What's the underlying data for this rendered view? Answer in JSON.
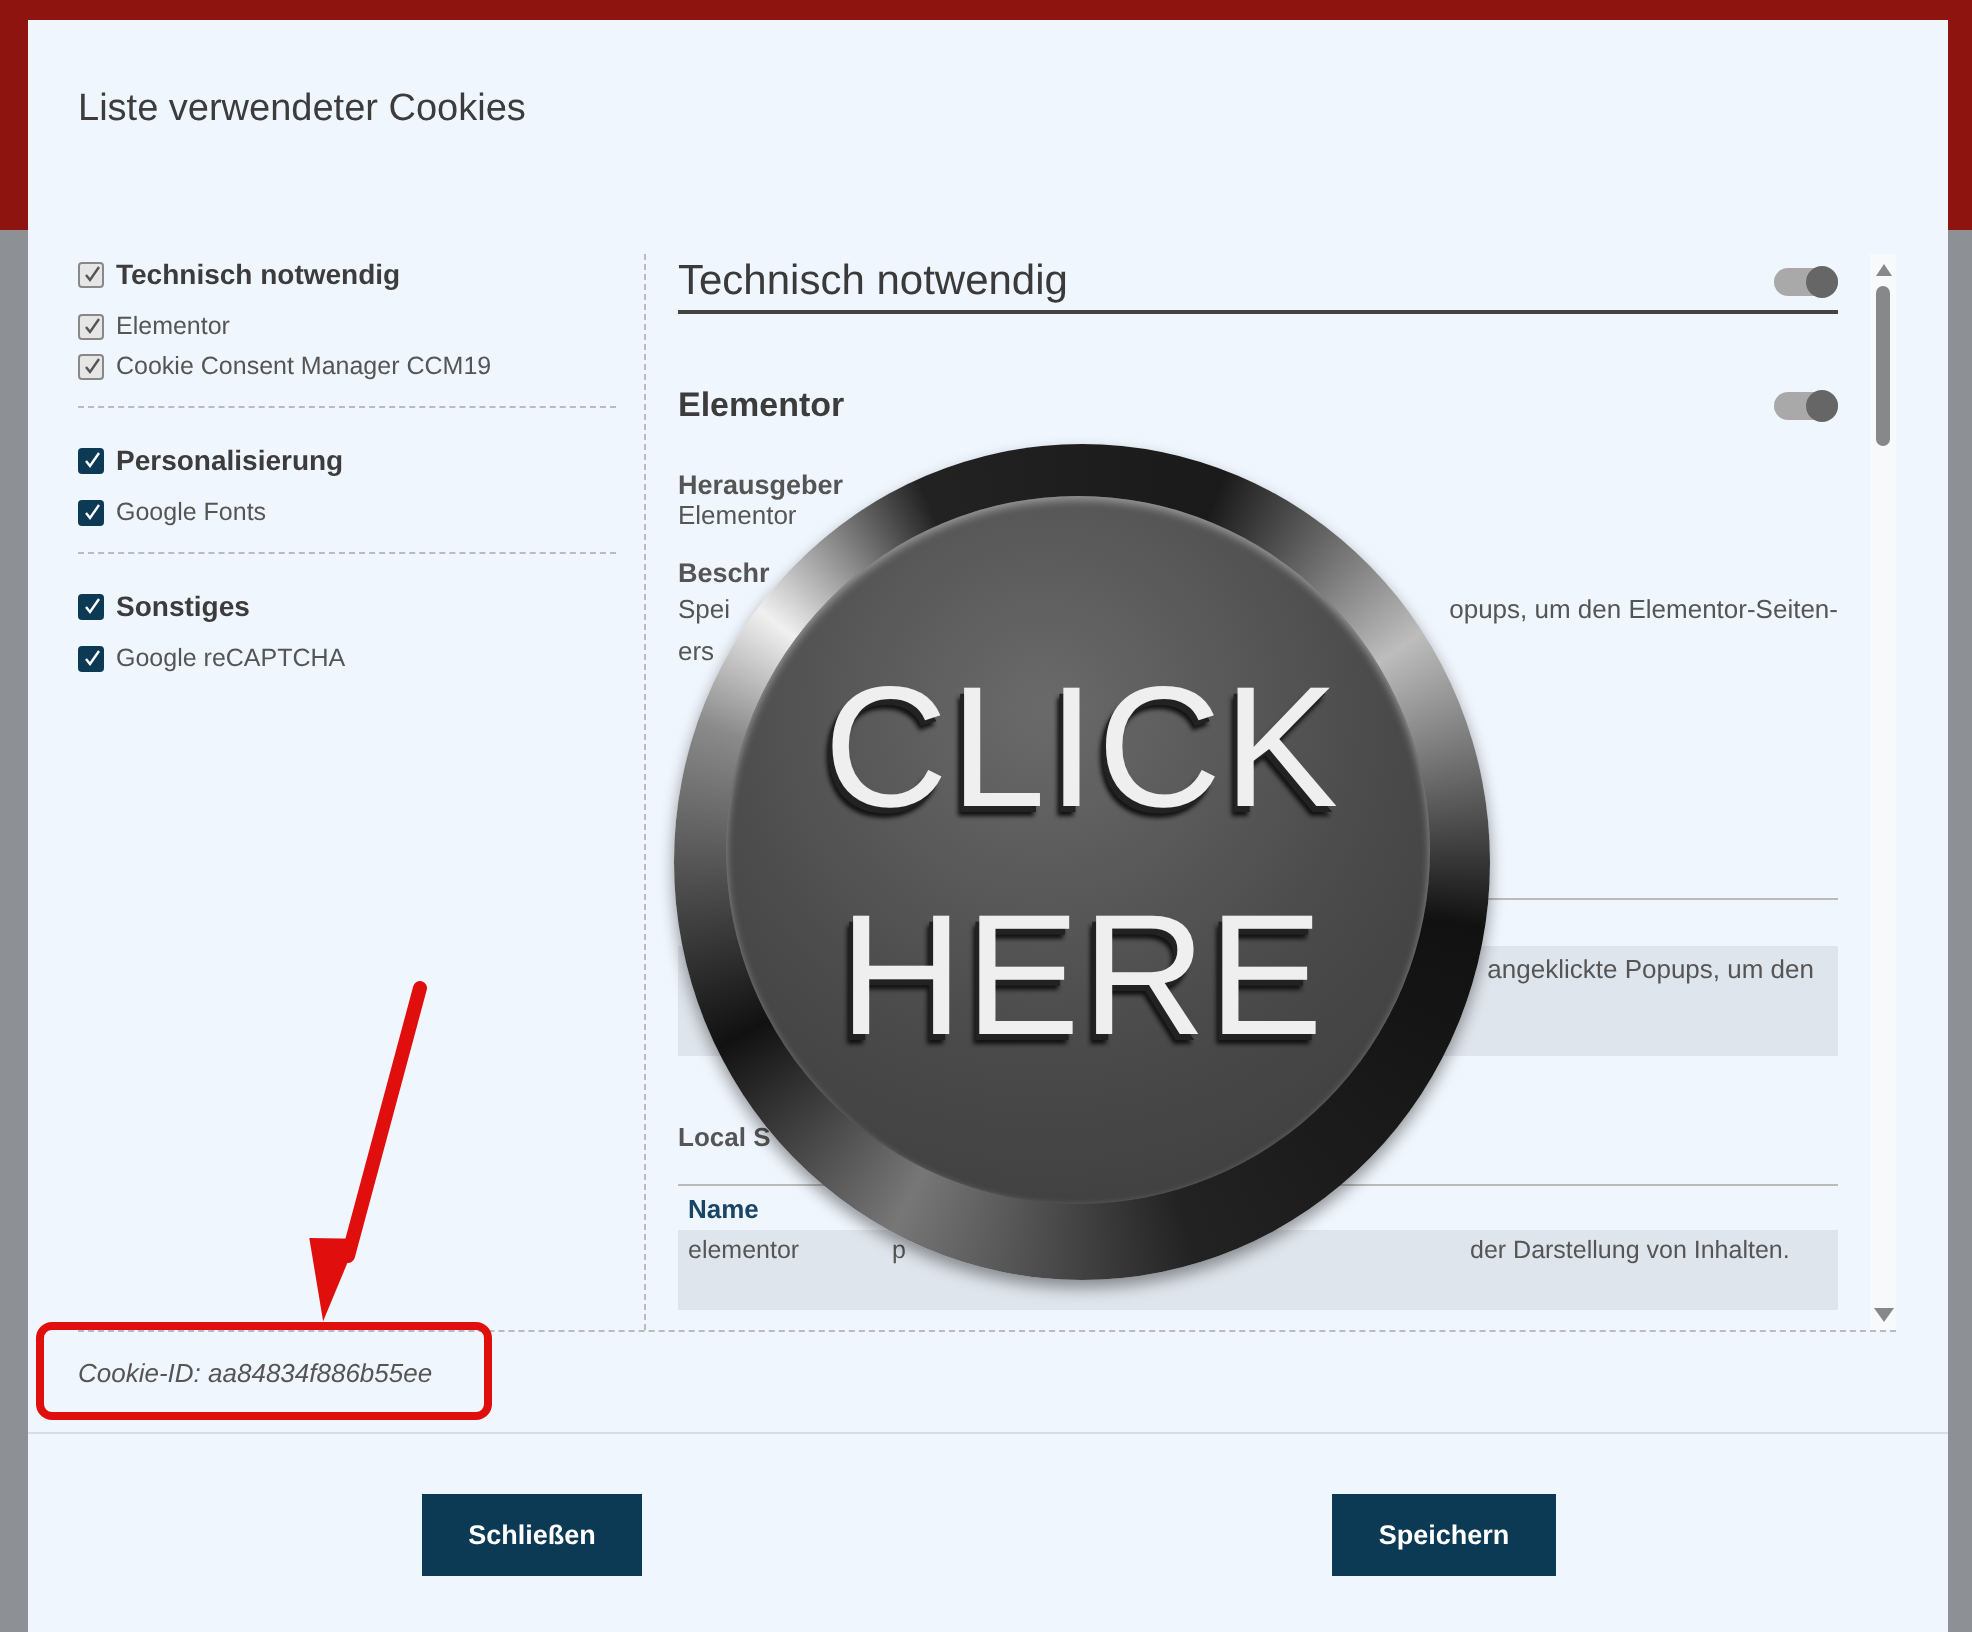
{
  "dialog": {
    "title": "Liste verwendeter Cookies"
  },
  "categories": [
    {
      "label": "Technisch notwendig",
      "checked": true,
      "disabled": true,
      "items": [
        {
          "label": "Elementor",
          "checked": true,
          "disabled": true
        },
        {
          "label": "Cookie Consent Manager CCM19",
          "checked": true,
          "disabled": true
        }
      ]
    },
    {
      "label": "Personalisierung",
      "checked": true,
      "disabled": false,
      "items": [
        {
          "label": "Google Fonts",
          "checked": true,
          "disabled": false
        }
      ]
    },
    {
      "label": "Sonstiges",
      "checked": true,
      "disabled": false,
      "items": [
        {
          "label": "Google reCAPTCHA",
          "checked": true,
          "disabled": false
        }
      ]
    }
  ],
  "detail": {
    "heading": "Technisch notwendig",
    "heading_on": true,
    "cookie": {
      "name": "Elementor",
      "on": true
    },
    "publisher_label": "Herausgeber",
    "publisher": "Elementor",
    "description_label": "Beschr",
    "description_lines": [
      {
        "start": "Spei",
        "end": "opups, um den Elementor-Seiten-"
      },
      {
        "start": "ers"
      }
    ],
    "table_1": {
      "row_end": "angeklickte Popups, um den"
    },
    "local_storage_label": "Local S",
    "table_2": {
      "columns": [
        "Name"
      ],
      "rows": [
        {
          "name": "elementor",
          "column_2": "p",
          "column_3": "der Darstellung von Inhalten."
        }
      ]
    }
  },
  "cookie_id": "Cookie-ID: aa84834f886b55ee",
  "buttons": [
    {
      "label": "Schließen"
    },
    {
      "label": "Speichern"
    }
  ],
  "sticker": {
    "lines": [
      "CLICK",
      "HERE"
    ]
  }
}
